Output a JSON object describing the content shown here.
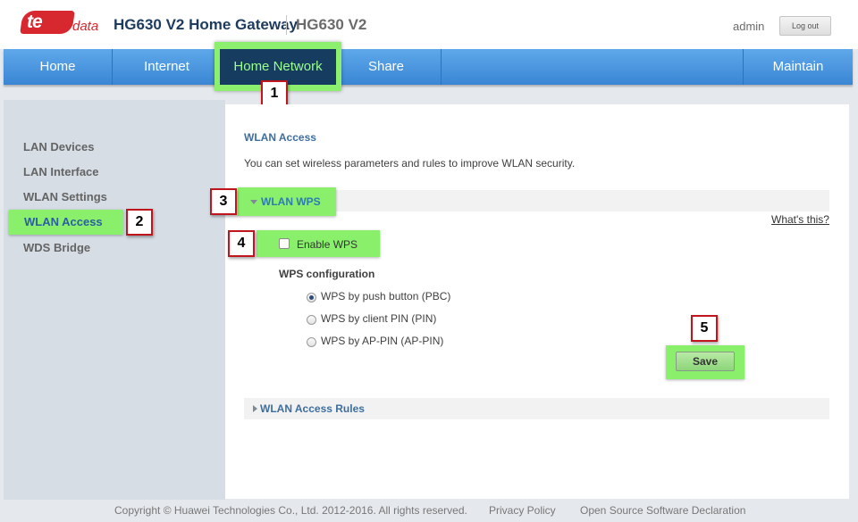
{
  "brand": {
    "logo_text": "te",
    "logo_sub": "data",
    "app_title": "HG630 V2 Home Gateway",
    "model": "HG630 V2"
  },
  "user": {
    "name": "admin",
    "logout_label": "Log out"
  },
  "nav": {
    "items": [
      {
        "label": "Home"
      },
      {
        "label": "Internet"
      },
      {
        "label": "Home Network",
        "active": true
      },
      {
        "label": "Share"
      },
      {
        "label": "Maintain"
      }
    ]
  },
  "sidebar": {
    "items": [
      {
        "label": "LAN Devices"
      },
      {
        "label": "LAN Interface"
      },
      {
        "label": "WLAN Settings"
      },
      {
        "label": "WLAN Access",
        "active": true
      },
      {
        "label": "WDS Bridge"
      }
    ]
  },
  "content": {
    "title": "WLAN Access",
    "description": "You can set wireless parameters and rules to improve WLAN security.",
    "wps_section": "WLAN WPS",
    "whats_this": "What's this?",
    "enable_wps_label": "Enable WPS",
    "enable_wps_checked": false,
    "wps_config_label": "WPS configuration",
    "wps_options": [
      {
        "label": "WPS by push button (PBC)",
        "selected": true
      },
      {
        "label": "WPS by client PIN (PIN)",
        "selected": false
      },
      {
        "label": "WPS by AP-PIN (AP-PIN)",
        "selected": false
      }
    ],
    "save_label": "Save",
    "access_rules_section": "WLAN Access Rules"
  },
  "callouts": [
    "1",
    "2",
    "3",
    "4",
    "5"
  ],
  "footer": {
    "copyright": "Copyright © Huawei Technologies Co., Ltd. 2012-2016. All rights reserved.",
    "privacy": "Privacy Policy",
    "open_source": "Open Source Software Declaration"
  },
  "colors": {
    "brand_red": "#d8282f",
    "nav_blue": "#3a86d4",
    "highlight_green": "#8af06c",
    "callout_border": "#c0151c"
  }
}
